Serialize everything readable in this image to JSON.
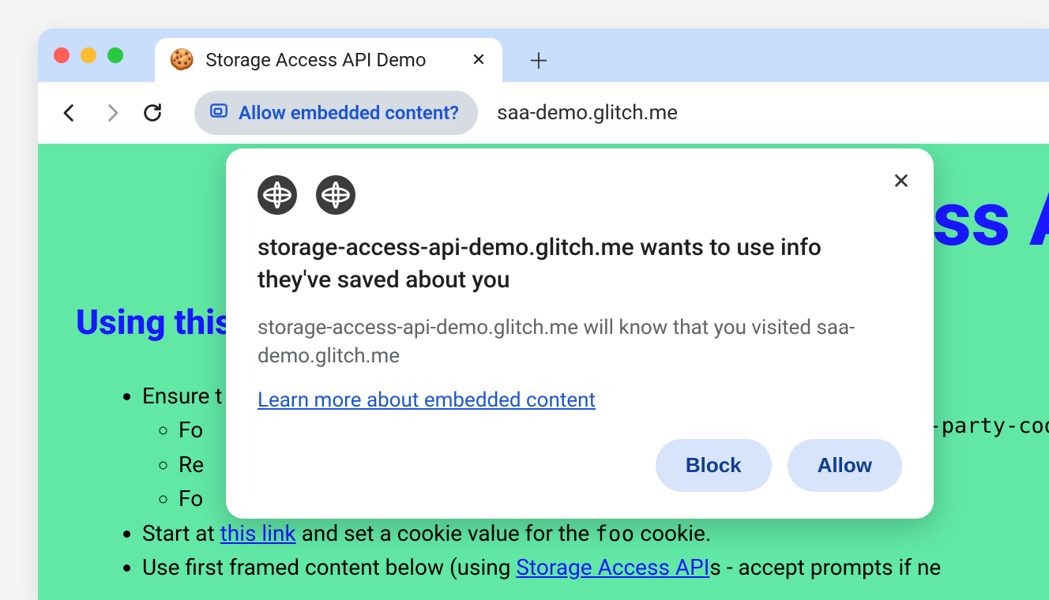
{
  "browser": {
    "tab": {
      "favicon": "🍪",
      "title": "Storage Access API Demo"
    },
    "chip_label": "Allow embedded content?",
    "url": "saa-demo.glitch.me"
  },
  "page": {
    "hero_fragment": "ss A",
    "section_heading": "Using this",
    "list": {
      "ensure": "Ensure t",
      "sub1": "Fo",
      "sub2": "Re",
      "sub3": "Fo",
      "start_prefix": "Start at ",
      "start_link": "this link",
      "start_mid": " and set a cookie value for the ",
      "start_code": "foo",
      "start_suffix": " cookie.",
      "use_prefix": "Use first framed content below (using ",
      "use_link": "Storage Access API",
      "use_suffix": "s - accept prompts if ne"
    },
    "right_code_fragment": "-party-coo"
  },
  "popup": {
    "title": "storage-access-api-demo.glitch.me wants to use info they've saved about you",
    "body": "storage-access-api-demo.glitch.me will know that you visited saa-demo.glitch.me",
    "learn_more": "Learn more about embedded content",
    "block_label": "Block",
    "allow_label": "Allow"
  }
}
